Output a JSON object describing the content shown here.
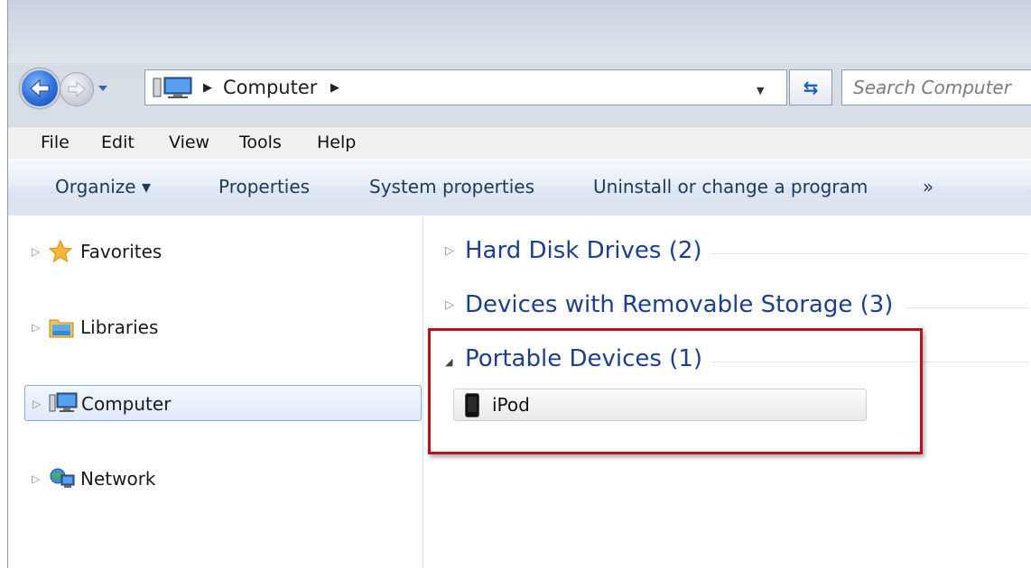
{
  "address": {
    "location": "Computer"
  },
  "search": {
    "placeholder": "Search Computer"
  },
  "menu": [
    "File",
    "Edit",
    "View",
    "Tools",
    "Help"
  ],
  "commands": {
    "organize": "Organize ▾",
    "properties": "Properties",
    "system_properties": "System properties",
    "uninstall": "Uninstall or change a program",
    "more": "»"
  },
  "nav": {
    "items": [
      {
        "label": "Favorites",
        "icon": "star-icon"
      },
      {
        "label": "Libraries",
        "icon": "libraries-folder-icon"
      },
      {
        "label": "Computer",
        "icon": "computer-icon",
        "selected": true
      },
      {
        "label": "Network",
        "icon": "network-icon"
      }
    ]
  },
  "groups": [
    {
      "title": "Hard Disk Drives (2)",
      "expanded": false
    },
    {
      "title": "Devices with Removable Storage (3)",
      "expanded": false
    },
    {
      "title": "Portable Devices (1)",
      "expanded": true,
      "items": [
        {
          "label": "iPod",
          "icon": "ipod-icon"
        }
      ]
    }
  ],
  "colors": {
    "highlight_border": "#b5111e",
    "group_title": "#1e3f8a",
    "back_button": "#2e6fd8"
  }
}
